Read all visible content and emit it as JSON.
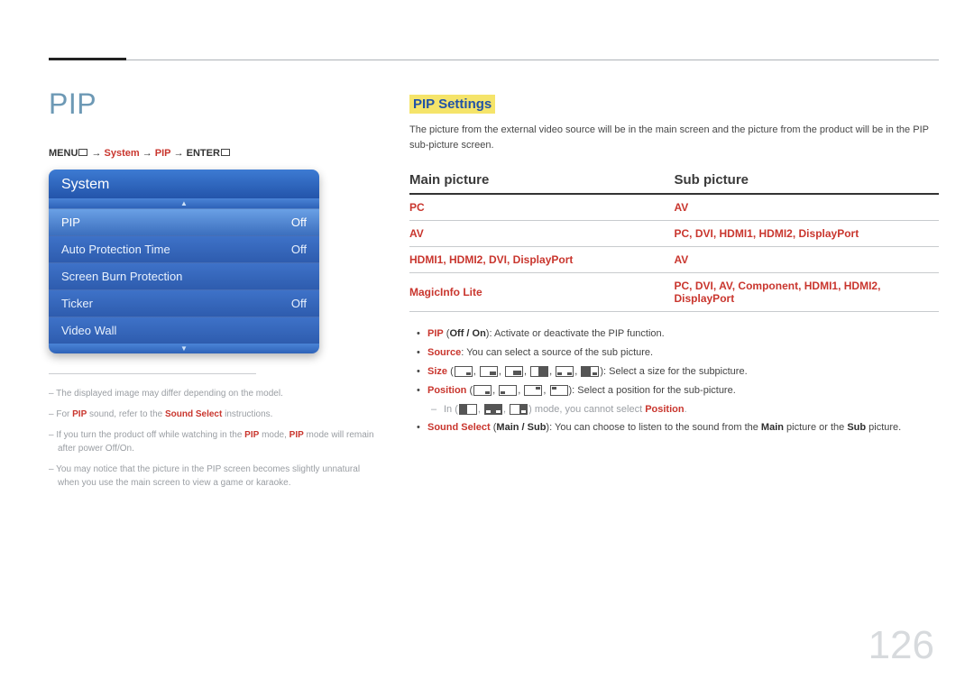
{
  "page_number": "126",
  "left": {
    "heading": "PIP",
    "breadcrumb": {
      "menu": "MENU",
      "step1": "System",
      "step2": "PIP",
      "enter": "ENTER"
    },
    "osd": {
      "title": "System",
      "rows": [
        {
          "label": "PIP",
          "value": "Off",
          "selected": true
        },
        {
          "label": "Auto Protection Time",
          "value": "Off",
          "selected": false
        },
        {
          "label": "Screen Burn Protection",
          "value": "",
          "selected": false
        },
        {
          "label": "Ticker",
          "value": "Off",
          "selected": false
        },
        {
          "label": "Video Wall",
          "value": "",
          "selected": false
        }
      ]
    },
    "footnotes": {
      "n1": "The displayed image may differ depending on the model.",
      "n2_a": "For ",
      "n2_b": "PIP",
      "n2_c": " sound, refer to the ",
      "n2_d": "Sound Select",
      "n2_e": " instructions.",
      "n3_a": "If you turn the product off while watching in the ",
      "n3_b": "PIP",
      "n3_c": " mode, ",
      "n3_d": "PIP",
      "n3_e": " mode will remain after power Off/On.",
      "n4": "You may notice that the picture in the PIP screen becomes slightly unnatural when you use the main screen to view a game or karaoke."
    }
  },
  "right": {
    "section_title": "PIP Settings",
    "intro": "The picture from the external video source will be in the main screen and the picture from the product will be in the PIP sub-picture screen.",
    "table": {
      "head_main": "Main picture",
      "head_sub": "Sub picture",
      "rows": [
        {
          "main": "PC",
          "sub": "AV"
        },
        {
          "main": "AV",
          "sub": "PC, DVI, HDMI1, HDMI2, DisplayPort"
        },
        {
          "main": "HDMI1, HDMI2, DVI, DisplayPort",
          "sub": "AV"
        },
        {
          "main": "MagicInfo Lite",
          "sub": "PC, DVI, AV, Component, HDMI1, HDMI2, DisplayPort"
        }
      ]
    },
    "bullets": {
      "pip_label": "PIP",
      "pip_opts": "Off / On",
      "pip_desc": ": Activate or deactivate the PIP function.",
      "source_label": "Source",
      "source_desc": ": You can select a source of the sub picture.",
      "size_label": "Size",
      "size_desc": ": Select a size for the subpicture.",
      "position_label": "Position",
      "position_desc": ": Select a position for the sub-picture.",
      "note_pre": "In",
      "note_mid": " mode, you cannot select ",
      "note_pos": "Position",
      "note_end": ".",
      "sound_label": "Sound Select",
      "sound_opts": "Main / Sub",
      "sound_desc_a": ": You can choose to listen to the sound from the ",
      "sound_desc_b": "Main",
      "sound_desc_c": " picture or the ",
      "sound_desc_d": "Sub",
      "sound_desc_e": " picture."
    }
  }
}
